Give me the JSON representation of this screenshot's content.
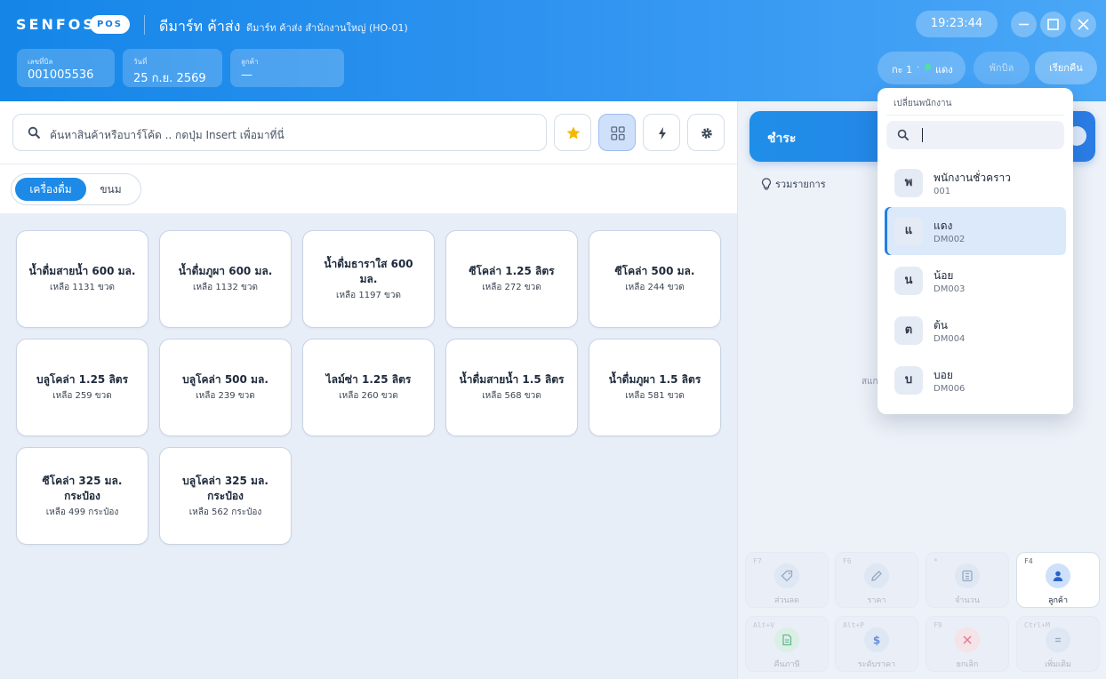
{
  "header": {
    "brand": "SENFOS",
    "brand_tag": "POS",
    "store_name": "ดีมาร์ท ค้าส่ง",
    "branch": "ดีมาร์ท ค้าส่ง สำนักงานใหญ่ (HO-01)",
    "time": "19:23:44",
    "bill": {
      "label": "เลขที่บิล",
      "value": "001005536"
    },
    "date": {
      "label": "วันที่",
      "value": "25 ก.ย. 2569"
    },
    "customer": {
      "label": "ลูกค้า",
      "value": "—"
    },
    "shift_label": "กะ 1",
    "shift_sep": "·",
    "shift_employee": "แดง",
    "hold_bill": "พักบิล",
    "recall_bill": "เรียกคืน"
  },
  "search": {
    "placeholder": "ค้นหาสินค้าหรือบาร์โค้ด .. กดปุ่ม Insert เพื่อมาที่นี่"
  },
  "categories": [
    {
      "label": "เครื่องดื่ม",
      "active": true
    },
    {
      "label": "ขนม",
      "active": false
    }
  ],
  "products": [
    {
      "name": "น้ำดื่มสายน้ำ 600 มล.",
      "stock": "เหลือ 1131 ขวด"
    },
    {
      "name": "น้ำดื่มภูผา 600 มล.",
      "stock": "เหลือ 1132 ขวด"
    },
    {
      "name": "น้ำดื่มธาราใส 600 มล.",
      "stock": "เหลือ 1197 ขวด"
    },
    {
      "name": "ซีโคล่า 1.25 ลิตร",
      "stock": "เหลือ 272 ขวด"
    },
    {
      "name": "ซีโคล่า 500 มล.",
      "stock": "เหลือ 244 ขวด"
    },
    {
      "name": "บลูโคล่า 1.25 ลิตร",
      "stock": "เหลือ 259 ขวด"
    },
    {
      "name": "บลูโคล่า 500 มล.",
      "stock": "เหลือ 239 ขวด"
    },
    {
      "name": "ไลม์ซ่า 1.25 ลิตร",
      "stock": "เหลือ 260 ขวด"
    },
    {
      "name": "น้ำดื่มสายน้ำ 1.5 ลิตร",
      "stock": "เหลือ 568 ขวด"
    },
    {
      "name": "น้ำดื่มภูผา 1.5 ลิตร",
      "stock": "เหลือ 581 ขวด"
    },
    {
      "name": "ซีโคล่า 325 มล. กระป๋อง",
      "stock": "เหลือ 499 กระป๋อง"
    },
    {
      "name": "บลูโคล่า 325 มล. กระป๋อง",
      "stock": "เหลือ 562 กระป๋อง"
    }
  ],
  "cart": {
    "pay_label": "ชำระ",
    "summary_label": "รวมรายการ",
    "peek_text": "สแกน"
  },
  "function_keys": [
    {
      "key": "F7",
      "label": "ส่วนลด",
      "icon": "tag-icon",
      "active": false
    },
    {
      "key": "F6",
      "label": "ราคา",
      "icon": "pencil-icon",
      "active": false
    },
    {
      "key": "*",
      "label": "จำนวน",
      "icon": "calculator-icon",
      "active": false
    },
    {
      "key": "F4",
      "label": "ลูกค้า",
      "icon": "user-icon",
      "active": true
    },
    {
      "key": "Alt+V",
      "label": "คืนภาษี",
      "icon": "document-icon",
      "active": false
    },
    {
      "key": "Alt+P",
      "label": "ระดับราคา",
      "icon": "dollar-icon",
      "active": false
    },
    {
      "key": "F9",
      "label": "ยกเลิก",
      "icon": "close-icon",
      "active": false
    },
    {
      "key": "Ctrl+M",
      "label": "เพิ่มเติม",
      "icon": "menu-icon",
      "active": false
    }
  ],
  "employee_switch": {
    "title": "เปลี่ยนพนักงาน",
    "search_value": "",
    "employees": [
      {
        "initial": "พ",
        "name": "พนักงานชั่วคราว",
        "code": "001",
        "selected": false
      },
      {
        "initial": "แ",
        "name": "แดง",
        "code": "DM002",
        "selected": true
      },
      {
        "initial": "น",
        "name": "น้อย",
        "code": "DM003",
        "selected": false
      },
      {
        "initial": "ต",
        "name": "ต้น",
        "code": "DM004",
        "selected": false
      },
      {
        "initial": "บ",
        "name": "บอย",
        "code": "DM006",
        "selected": false
      }
    ]
  },
  "colors": {
    "accent": "#1d8ae8",
    "header_start": "#1486e8",
    "header_end": "#4aa7f7",
    "online": "#4de39a",
    "star": "#f5b800"
  }
}
